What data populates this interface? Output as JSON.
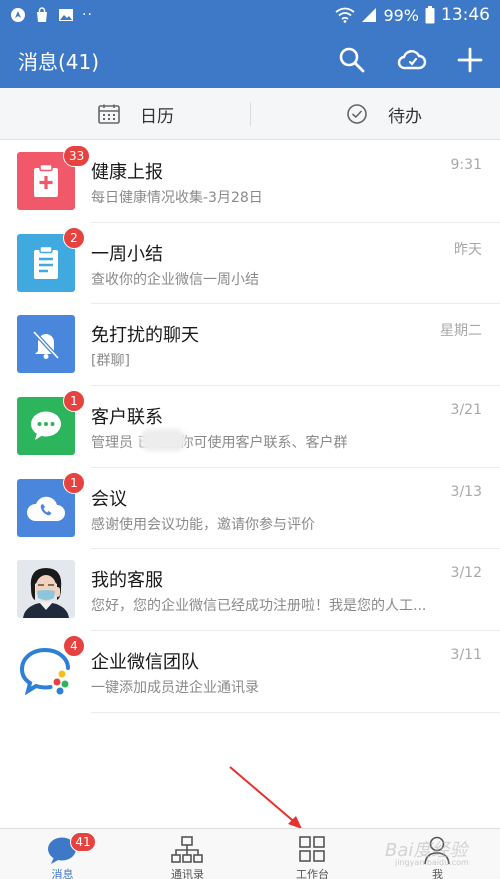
{
  "status_bar": {
    "battery": "99%",
    "time": "13:46"
  },
  "header": {
    "title": "消息(41)"
  },
  "subbar": {
    "calendar_label": "日历",
    "todo_label": "待办"
  },
  "conversations": [
    {
      "name": "健康上报",
      "subtitle": "每日健康情况收集-3月28日",
      "time": "9:31",
      "badge": "33",
      "avatar_color": "#f1586a",
      "icon": "first-aid-icon"
    },
    {
      "name": "一周小结",
      "subtitle": "查收你的企业微信一周小结",
      "time": "昨天",
      "badge": "2",
      "avatar_color": "#3fa9e0",
      "icon": "clipboard-icon"
    },
    {
      "name": "免打扰的聊天",
      "subtitle": "[群聊]",
      "time": "星期二",
      "badge": "",
      "avatar_color": "#4a86dc",
      "icon": "bell-off-icon"
    },
    {
      "name": "客户联系",
      "subtitle": "管理员        已配置你可使用客户联系、客户群",
      "time": "3/21",
      "badge": "1",
      "avatar_color": "#2db55d",
      "icon": "chat-bubble-icon"
    },
    {
      "name": "会议",
      "subtitle": "感谢使用会议功能，邀请你参与评价",
      "time": "3/13",
      "badge": "1",
      "avatar_color": "#4a86dc",
      "icon": "phone-cloud-icon"
    },
    {
      "name": "我的客服",
      "subtitle": "您好，您的企业微信已经成功注册啦！我是您的人工...",
      "time": "3/12",
      "badge": "",
      "avatar_color": "#d9dde2",
      "icon": "person-photo-icon"
    },
    {
      "name": "企业微信团队",
      "subtitle": "一键添加成员进企业通讯录",
      "time": "3/11",
      "badge": "4",
      "avatar_color": "#ffffff",
      "icon": "wecom-logo-icon"
    }
  ],
  "tabs": [
    {
      "label": "消息",
      "badge": "41",
      "icon": "message-icon",
      "active": true
    },
    {
      "label": "通讯录",
      "badge": "",
      "icon": "org-chart-icon",
      "active": false
    },
    {
      "label": "工作台",
      "badge": "",
      "icon": "grid-icon",
      "active": false
    },
    {
      "label": "我",
      "badge": "",
      "icon": "person-icon",
      "active": false
    }
  ],
  "watermark": {
    "text": "Bai度经验",
    "sub": "jingyan.baidu.com"
  },
  "colors": {
    "primary": "#3d79c6",
    "badge": "#e64340"
  }
}
